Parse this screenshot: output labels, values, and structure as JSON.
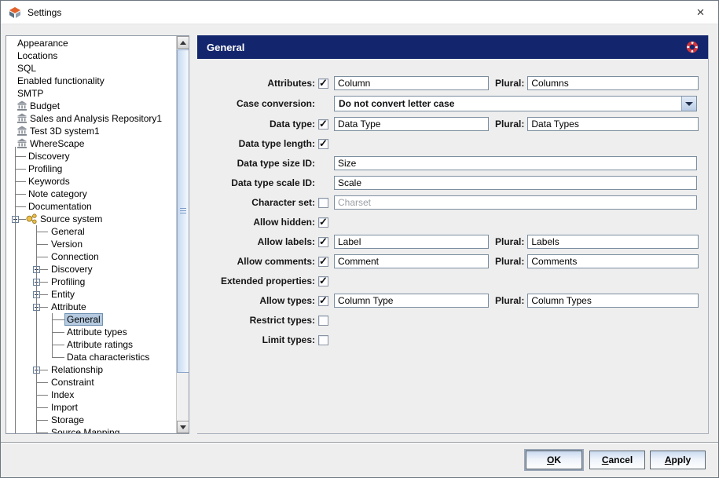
{
  "window": {
    "title": "Settings",
    "close_glyph": "×"
  },
  "tree": {
    "items": [
      {
        "label": "Appearance",
        "depth": 0
      },
      {
        "label": "Locations",
        "depth": 0
      },
      {
        "label": "SQL",
        "depth": 0
      },
      {
        "label": "Enabled functionality",
        "depth": 0
      },
      {
        "label": "SMTP",
        "depth": 0
      },
      {
        "label": "Budget",
        "depth": 0,
        "icon": "repository"
      },
      {
        "label": "Sales and Analysis Repository1",
        "depth": 0,
        "icon": "repository"
      },
      {
        "label": "Test 3D system1",
        "depth": 0,
        "icon": "repository"
      },
      {
        "label": "WhereScape",
        "depth": 0,
        "icon": "repository"
      },
      {
        "label": "Discovery",
        "depth": 1
      },
      {
        "label": "Profiling",
        "depth": 1
      },
      {
        "label": "Keywords",
        "depth": 1
      },
      {
        "label": "Note category",
        "depth": 1
      },
      {
        "label": "Documentation",
        "depth": 1
      },
      {
        "label": "Source system",
        "depth": 1,
        "expander": "minus",
        "icon": "source-system"
      },
      {
        "label": "General",
        "depth": 2
      },
      {
        "label": "Version",
        "depth": 2
      },
      {
        "label": "Connection",
        "depth": 2
      },
      {
        "label": "Discovery",
        "depth": 2,
        "expander": "plus"
      },
      {
        "label": "Profiling",
        "depth": 2,
        "expander": "plus"
      },
      {
        "label": "Entity",
        "depth": 2,
        "expander": "plus"
      },
      {
        "label": "Attribute",
        "depth": 2,
        "expander": "minus"
      },
      {
        "label": "General",
        "depth": 3,
        "selected": true
      },
      {
        "label": "Attribute types",
        "depth": 3
      },
      {
        "label": "Attribute ratings",
        "depth": 3
      },
      {
        "label": "Data characteristics",
        "depth": 3
      },
      {
        "label": "Relationship",
        "depth": 2,
        "expander": "plus"
      },
      {
        "label": "Constraint",
        "depth": 2
      },
      {
        "label": "Index",
        "depth": 2
      },
      {
        "label": "Import",
        "depth": 2
      },
      {
        "label": "Storage",
        "depth": 2
      },
      {
        "label": "Source Mapping",
        "depth": 2
      }
    ]
  },
  "panel": {
    "title": "General"
  },
  "form": {
    "rows": [
      {
        "label": "Attributes:",
        "checkbox": "checked",
        "value": "Column",
        "plural_label": "Plural:",
        "plural_value": "Columns"
      },
      {
        "label": "Case conversion:",
        "combo": "Do not convert letter case"
      },
      {
        "label": "Data type:",
        "checkbox": "checked",
        "value": "Data Type",
        "plural_label": "Plural:",
        "plural_value": "Data Types"
      },
      {
        "label": "Data type length:",
        "checkbox": "checked"
      },
      {
        "label": "Data type size ID:",
        "value": "Size",
        "wide": true
      },
      {
        "label": "Data type scale ID:",
        "value": "Scale",
        "wide": true
      },
      {
        "label": "Character set:",
        "checkbox": "unchecked",
        "value": "Charset",
        "wide": true,
        "disabled": true
      },
      {
        "label": "Allow hidden:",
        "checkbox": "checked"
      },
      {
        "label": "Allow labels:",
        "checkbox": "checked",
        "value": "Label",
        "plural_label": "Plural:",
        "plural_value": "Labels"
      },
      {
        "label": "Allow comments:",
        "checkbox": "checked",
        "value": "Comment",
        "plural_label": "Plural:",
        "plural_value": "Comments"
      },
      {
        "label": "Extended properties:",
        "checkbox": "checked"
      },
      {
        "label": "Allow types:",
        "checkbox": "checked",
        "value": "Column Type",
        "plural_label": "Plural:",
        "plural_value": "Column Types"
      },
      {
        "label": "Restrict types:",
        "checkbox": "unchecked"
      },
      {
        "label": "Limit types:",
        "checkbox": "unchecked"
      }
    ]
  },
  "buttons": {
    "ok": "OK",
    "cancel": "Cancel",
    "apply": "Apply"
  },
  "colors": {
    "header_bg": "#13266d",
    "selection_bg": "#b5cae0",
    "help_red": "#d2353c"
  }
}
